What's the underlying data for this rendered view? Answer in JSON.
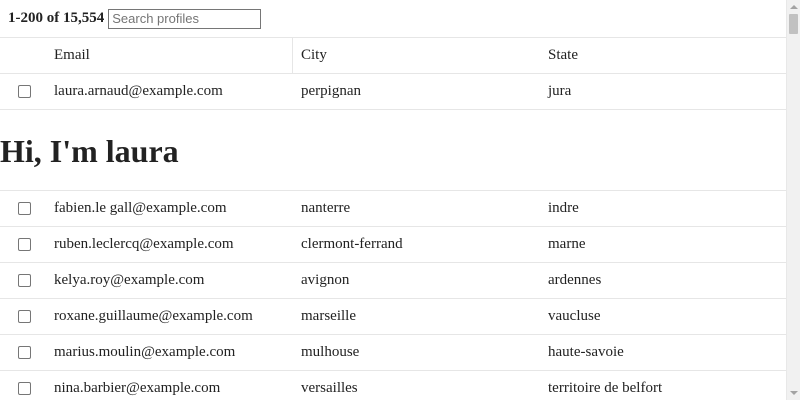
{
  "toolbar": {
    "count_label": "1-200 of 15,554",
    "search_placeholder": "Search profiles",
    "search_value": ""
  },
  "table": {
    "columns": [
      "Email",
      "City",
      "State"
    ],
    "rows_before": [
      {
        "email": "laura.arnaud@example.com",
        "city": "perpignan",
        "state": "jura"
      }
    ],
    "expanded_profile": {
      "title": "Hi, I'm laura"
    },
    "rows_after": [
      {
        "email": "fabien.le gall@example.com",
        "city": "nanterre",
        "state": "indre"
      },
      {
        "email": "ruben.leclercq@example.com",
        "city": "clermont-ferrand",
        "state": "marne"
      },
      {
        "email": "kelya.roy@example.com",
        "city": "avignon",
        "state": "ardennes"
      },
      {
        "email": "roxane.guillaume@example.com",
        "city": "marseille",
        "state": "vaucluse"
      },
      {
        "email": "marius.moulin@example.com",
        "city": "mulhouse",
        "state": "haute-savoie"
      },
      {
        "email": "nina.barbier@example.com",
        "city": "versailles",
        "state": "territoire de belfort"
      }
    ]
  },
  "icons": {
    "row_select": "checkbox-unchecked",
    "scroll_up": "triangle-up-icon",
    "scroll_down": "triangle-down-icon"
  }
}
